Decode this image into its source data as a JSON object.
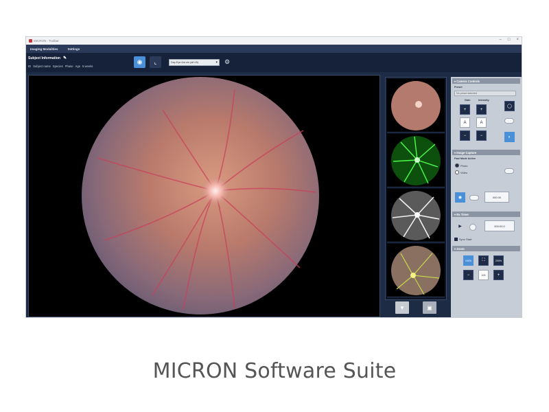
{
  "window": {
    "title": "MICRON - Toolbar"
  },
  "menu": {
    "items": [
      "Imaging Modalities",
      "Settings"
    ]
  },
  "subject": {
    "title": "Subject Information",
    "fields": [
      "ID",
      "Subject name",
      "Species",
      "Phase",
      "Age",
      "5 weeks"
    ]
  },
  "toolbar": {
    "device_select": "Day Eye Ant nin (all LB)"
  },
  "controls": {
    "camera": {
      "header": "Camera Controls",
      "preset_label": "Preset",
      "preset_value": "No preset selected",
      "gain_label": "Gain",
      "intensity_label": "Intensity",
      "plus": "+",
      "minus": "−",
      "auto": "A"
    },
    "capture": {
      "header": "Image Capture",
      "mode_label": "Fast Mode Active",
      "photo_label": "Photo",
      "video_label": "Video",
      "capture_field": "000.00"
    },
    "timer": {
      "header": "Rx Timer",
      "field": "000:00.0",
      "sync_label": "Sync Start"
    },
    "zoom": {
      "header": "Zoom",
      "fit_label": "100%",
      "max_label": "200%",
      "value": "100"
    }
  },
  "caption": "MICRON Software Suite"
}
